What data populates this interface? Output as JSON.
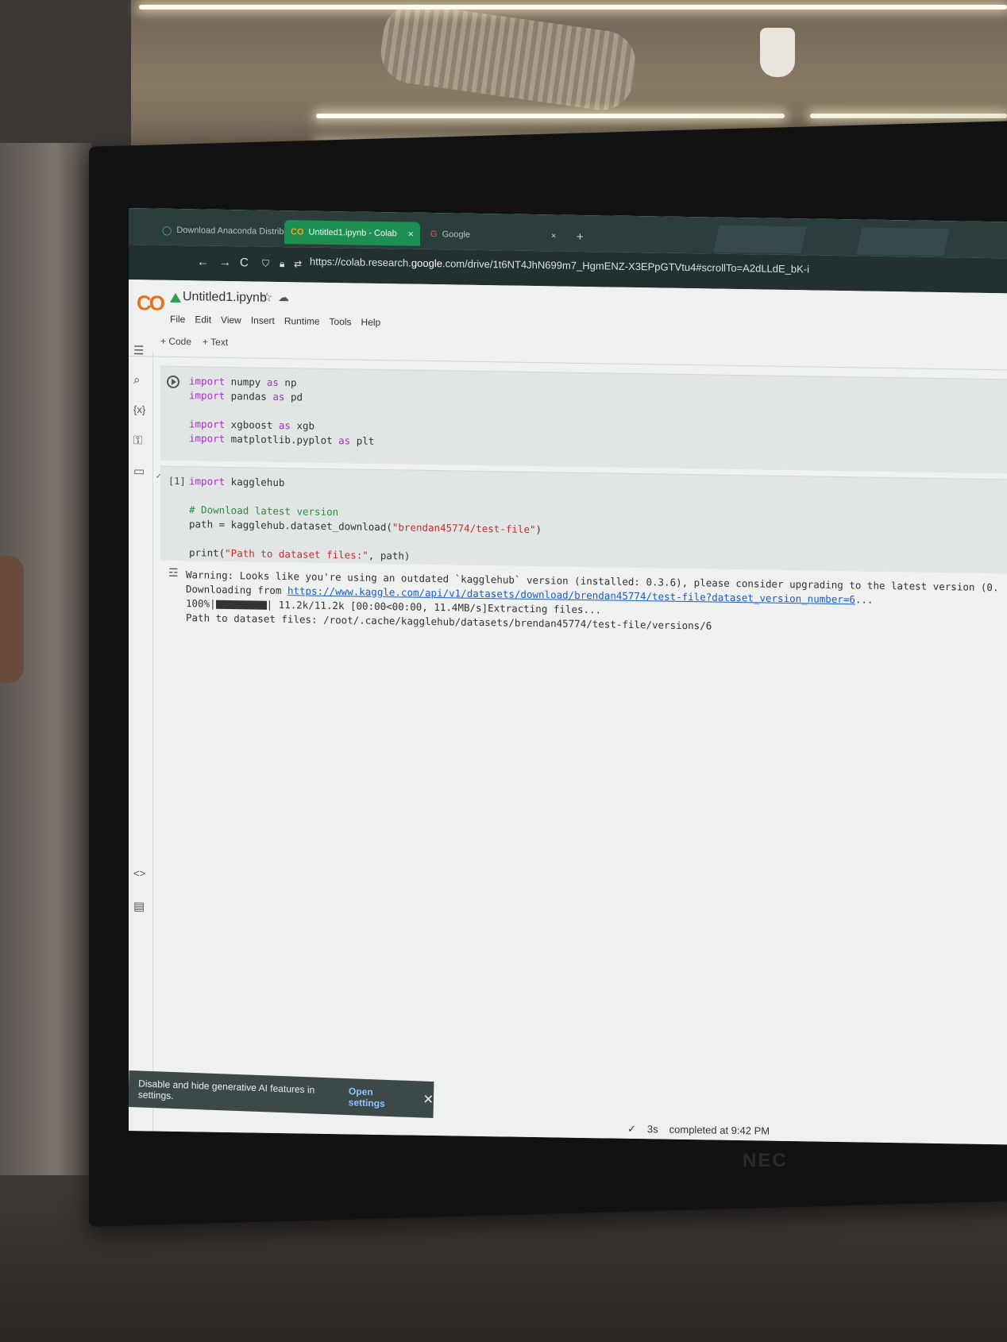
{
  "browser": {
    "tabs": [
      {
        "label": "Download Anaconda Distributio",
        "close": "×"
      },
      {
        "label": "Untitled1.ipynb - Colab",
        "close": "×"
      },
      {
        "label": "Google"
      }
    ],
    "new_tab": "+",
    "close_window": "×",
    "url_prefix": "https://colab.research.",
    "url_domain": "google",
    "url_rest": ".com/drive/1t6NT4JhN699m7_HgmENZ-X3EPpGTVtu4#scrollTo=A2dLLdE_bK-i",
    "nav": {
      "back": "←",
      "forward": "→",
      "reload": "C"
    }
  },
  "colab": {
    "logo": "CO",
    "title": "Untitled1.ipynb",
    "star": "☆",
    "menu": [
      "File",
      "Edit",
      "View",
      "Insert",
      "Runtime",
      "Tools",
      "Help"
    ],
    "toolbar": {
      "code": "+ Code",
      "text": "+ Text"
    },
    "cell1": {
      "line1_kw": "import",
      "line1_rest": " numpy ",
      "line1_as": "as",
      "line1_alias": " np",
      "line2_kw": "import",
      "line2_rest": " pandas ",
      "line2_as": "as",
      "line2_alias": " pd",
      "line3_kw": "import",
      "line3_rest": " xgboost ",
      "line3_as": "as",
      "line3_alias": " xgb",
      "line4_kw": "import",
      "line4_rest": " matplotlib.pyplot ",
      "line4_as": "as",
      "line4_alias": " plt"
    },
    "cell2": {
      "exec_count": "[1]",
      "line1_kw": "import",
      "line1_rest": " kagglehub",
      "comment": "# Download latest version",
      "line3_pre": "path = kagglehub.dataset_download(",
      "line3_str": "\"brendan45774/test-file\"",
      "line3_post": ")",
      "line4_pre": "print(",
      "line4_str": "\"Path to dataset files:\"",
      "line4_post": ", path)"
    },
    "output": {
      "warning": "Warning: Looks like you're using an outdated `kagglehub` version (installed: 0.3.6), please consider upgrading to the latest version (0.",
      "downloading_pre": "Downloading from ",
      "download_url": "https://www.kaggle.com/api/v1/datasets/download/brendan45774/test-file?dataset_version_number=6",
      "downloading_post": "...",
      "progress_pct": "100%|",
      "progress_post": "| 11.2k/11.2k [00:00<00:00, 11.4MB/s]Extracting files...",
      "path_line": "Path to dataset files: /root/.cache/kagglehub/datasets/brendan45774/test-file/versions/6"
    },
    "toast": {
      "message": "Disable and hide generative AI features in settings.",
      "action": "Open settings",
      "close": "✕"
    },
    "status": {
      "check": "✓",
      "duration": "3s",
      "completed": "completed at 9:42 PM"
    }
  },
  "monitor": {
    "brand": "NEC"
  }
}
